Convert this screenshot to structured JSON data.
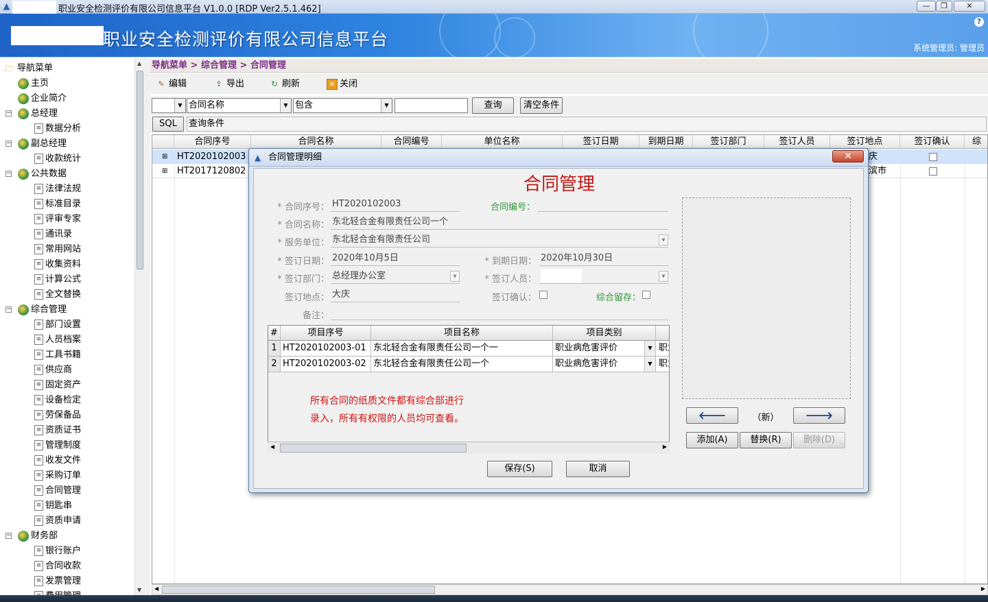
{
  "window": {
    "title": "职业安全检测评价有限公司信息平台 V1.0.0 [RDP Ver2.5.1.462]",
    "min_icon": "minimize-icon",
    "max_icon": "maximize-icon",
    "close_icon": "close-icon"
  },
  "banner": {
    "brand": "职业安全检测评价有限公司信息平台",
    "help": "?",
    "user": "系统管理员: 管理员"
  },
  "sidebar": {
    "root": "导航菜单",
    "items": [
      {
        "label": "主页",
        "level": 1
      },
      {
        "label": "企业简介",
        "level": 1
      },
      {
        "label": "总经理",
        "level": 1,
        "group": true
      },
      {
        "label": "数据分析",
        "level": 2
      },
      {
        "label": "副总经理",
        "level": 1,
        "group": true
      },
      {
        "label": "收款统计",
        "level": 2
      },
      {
        "label": "公共数据",
        "level": 1,
        "group": true
      },
      {
        "label": "法律法规",
        "level": 2
      },
      {
        "label": "标准目录",
        "level": 2
      },
      {
        "label": "评审专家",
        "level": 2
      },
      {
        "label": "通讯录",
        "level": 2
      },
      {
        "label": "常用网站",
        "level": 2
      },
      {
        "label": "收集资料",
        "level": 2
      },
      {
        "label": "计算公式",
        "level": 2
      },
      {
        "label": "全文替换",
        "level": 2
      },
      {
        "label": "综合管理",
        "level": 1,
        "group": true
      },
      {
        "label": "部门设置",
        "level": 2
      },
      {
        "label": "人员档案",
        "level": 2
      },
      {
        "label": "工具书籍",
        "level": 2
      },
      {
        "label": "供应商",
        "level": 2
      },
      {
        "label": "固定资产",
        "level": 2
      },
      {
        "label": "设备检定",
        "level": 2
      },
      {
        "label": "劳保备品",
        "level": 2
      },
      {
        "label": "资质证书",
        "level": 2
      },
      {
        "label": "管理制度",
        "level": 2
      },
      {
        "label": "收发文件",
        "level": 2
      },
      {
        "label": "采购订单",
        "level": 2
      },
      {
        "label": "合同管理",
        "level": 2
      },
      {
        "label": "钥匙串",
        "level": 2
      },
      {
        "label": "资质申请",
        "level": 2
      },
      {
        "label": "财务部",
        "level": 1,
        "group": true
      },
      {
        "label": "银行账户",
        "level": 2
      },
      {
        "label": "合同收款",
        "level": 2
      },
      {
        "label": "发票管理",
        "level": 2
      },
      {
        "label": "费用管理",
        "level": 2
      }
    ]
  },
  "breadcrumb": "导航菜单 > 综合管理 > 合同管理",
  "toolbar": {
    "edit": "编辑",
    "export": "导出",
    "refresh": "刷新",
    "close": "关闭"
  },
  "query": {
    "field": "合同名称",
    "operator": "包含",
    "value": "",
    "search_btn": "查询",
    "clear_btn": "清空条件",
    "sql_btn": "SQL",
    "condition_label": "查询条件"
  },
  "grid": {
    "columns": [
      "合同序号",
      "合同名称",
      "合同编号",
      "单位名称",
      "签订日期",
      "到期日期",
      "签订部门",
      "签订人员",
      "签订地点",
      "签订确认",
      "综"
    ],
    "rows": [
      {
        "id": "HT2020102003",
        "place": "庆"
      },
      {
        "id": "HT2017120802",
        "place": "滨市"
      }
    ]
  },
  "dialog": {
    "title": "合同管理明细",
    "heading": "合同管理",
    "close_label": "✕",
    "labels": {
      "contract_no": "* 合同序号：",
      "contract_code": "合同编号：",
      "contract_name": "* 合同名称：",
      "service_unit": "* 服务单位：",
      "sign_date": "* 签订日期：",
      "due_date": "* 到期日期：",
      "sign_dept": "* 签订部门：",
      "sign_person": "* 签订人员：",
      "sign_place": "签订地点：",
      "sign_confirm": "签订确认：",
      "archive": "综合留存：",
      "remark": "备注："
    },
    "values": {
      "contract_no": "HT2020102003",
      "contract_code": "",
      "contract_name": "东北轻合金有限责任公司一个",
      "service_unit": "东北轻合金有限责任公司",
      "sign_date": "2020年10月5日",
      "due_date": "2020年10月30日",
      "sign_dept": "总经理办公室",
      "sign_person": "",
      "sign_place": "大庆",
      "remark": ""
    },
    "items_grid": {
      "columns": [
        "#",
        "项目序号",
        "项目名称",
        "项目类别"
      ],
      "rows": [
        {
          "n": "1",
          "no": "HT2020102003-01",
          "name": "东北轻合金有限责任公司一个一",
          "type": "职业病危害评价",
          "extra": "职业"
        },
        {
          "n": "2",
          "no": "HT2020102003-02",
          "name": "东北轻合金有限责任公司一个",
          "type": "职业病危害评价",
          "extra": "职业"
        }
      ]
    },
    "note_line1": "所有合同的纸质文件都有综合部进行",
    "note_line2": "录入，所有有权限的人员均可查看。",
    "image_nav": {
      "prev": "🡐",
      "status": "（新）",
      "next": "🡒"
    },
    "add_btn": "添加(A)",
    "replace_btn": "替换(R)",
    "delete_btn": "删除(D)",
    "save_btn": "保存(S)",
    "cancel_btn": "取消"
  }
}
